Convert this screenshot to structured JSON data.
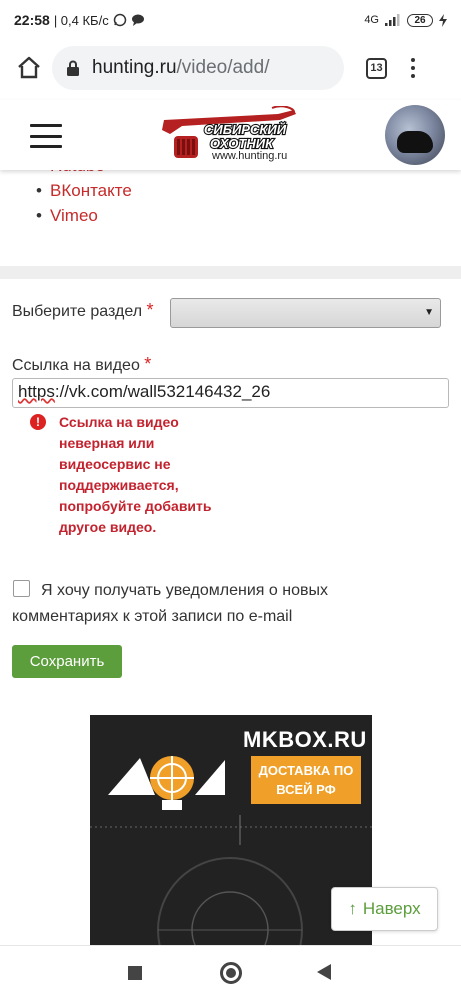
{
  "status_bar": {
    "time": "22:58",
    "network_speed": "| 0,4 КБ/с",
    "signal": "4G",
    "battery": "26"
  },
  "browser": {
    "url_host": "hunting.ru",
    "url_path": "/video/add/",
    "tab_count": "13"
  },
  "site_header": {
    "logo_url_text": "www.hunting.ru",
    "logo_lines": [
      "СИБИРСКИЙ",
      "ОХОТНИК"
    ]
  },
  "services_list": {
    "items": [
      "Rutube",
      "ВКонтакте",
      "Vimeo"
    ]
  },
  "form": {
    "section_label": "Выберите раздел",
    "required_mark": "*",
    "section_selected": "",
    "video_link_label": "Ссылка на видео",
    "video_link_value": "https://vk.com/wall532146432_26",
    "video_link_value_prefix": "https",
    "video_link_value_rest": "://vk.com/wall532146432_26",
    "error_icon": "!",
    "error_message": "Ссылка на видео неверная или видеосервис не поддерживается, попробуйте добавить другое видео.",
    "notify_checkbox_checked": false,
    "notify_label": "Я хочу получать уведомления о новых комментариях к этой записи по e-mail",
    "save_label": "Сохранить"
  },
  "ad_banner": {
    "brand": "MKBOX.RU",
    "delivery_text": "ДОСТАВКА ПО ВСЕЙ РФ"
  },
  "to_top": {
    "arrow": "↑",
    "label": "Наверх"
  },
  "colors": {
    "link_red": "#c62a2a",
    "error_red": "#c3232e",
    "save_green": "#5c9e3c",
    "ad_orange": "#f0a028"
  }
}
